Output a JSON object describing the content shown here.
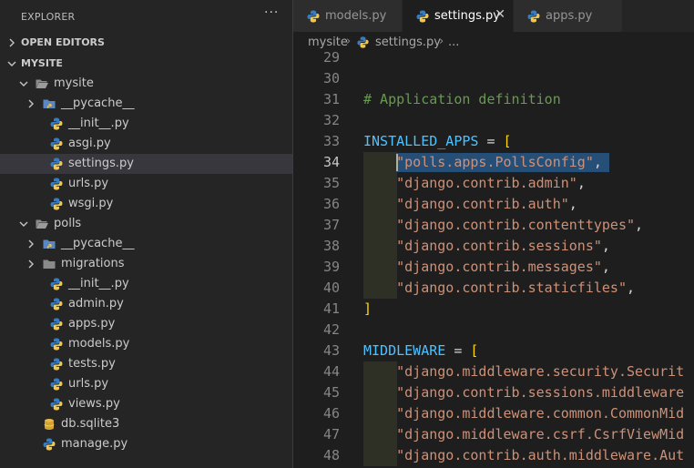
{
  "sidebar": {
    "title": "EXPLORER",
    "more_glyph": "···",
    "open_editors_label": "OPEN EDITORS",
    "project_label": "MYSITE",
    "items": [
      {
        "name": "mysite",
        "type": "folder",
        "expanded": true
      },
      {
        "name": "__pycache__",
        "type": "pycache-folder",
        "expanded": false
      },
      {
        "name": "__init__.py",
        "type": "python"
      },
      {
        "name": "asgi.py",
        "type": "python"
      },
      {
        "name": "settings.py",
        "type": "python",
        "selected": true
      },
      {
        "name": "urls.py",
        "type": "python"
      },
      {
        "name": "wsgi.py",
        "type": "python"
      },
      {
        "name": "polls",
        "type": "folder",
        "expanded": true
      },
      {
        "name": "__pycache__",
        "type": "pycache-folder",
        "expanded": false
      },
      {
        "name": "migrations",
        "type": "folder",
        "expanded": false
      },
      {
        "name": "__init__.py",
        "type": "python"
      },
      {
        "name": "admin.py",
        "type": "python"
      },
      {
        "name": "apps.py",
        "type": "python"
      },
      {
        "name": "models.py",
        "type": "python"
      },
      {
        "name": "tests.py",
        "type": "python"
      },
      {
        "name": "urls.py",
        "type": "python"
      },
      {
        "name": "views.py",
        "type": "python"
      },
      {
        "name": "db.sqlite3",
        "type": "database"
      },
      {
        "name": "manage.py",
        "type": "python"
      }
    ]
  },
  "tabs": [
    {
      "label": "models.py",
      "active": false
    },
    {
      "label": "settings.py",
      "active": true,
      "close_glyph": "✕"
    },
    {
      "label": "apps.py",
      "active": false
    }
  ],
  "breadcrumb": {
    "folder": "mysite",
    "file": "settings.py",
    "sep": "›",
    "tail": "..."
  },
  "editor": {
    "current_line": 34,
    "lines": [
      {
        "n": "29",
        "tokens": []
      },
      {
        "n": "30",
        "tokens": []
      },
      {
        "n": "31",
        "tokens": [
          {
            "t": "# Application definition",
            "k": "comment"
          }
        ]
      },
      {
        "n": "32",
        "tokens": []
      },
      {
        "n": "33",
        "tokens": [
          {
            "t": "INSTALLED_APPS",
            "k": "var"
          },
          {
            "t": " = ",
            "k": "op"
          },
          {
            "t": "[",
            "k": "br"
          }
        ]
      },
      {
        "n": "34",
        "guide": true,
        "tokens": [
          {
            "t": "    ",
            "k": "op"
          },
          {
            "t": "\"polls.apps.PollsConfig\"",
            "k": "str"
          },
          {
            "t": ",",
            "k": "op"
          }
        ]
      },
      {
        "n": "35",
        "guide": true,
        "tokens": [
          {
            "t": "    ",
            "k": "op"
          },
          {
            "t": "\"django.contrib.admin\"",
            "k": "str"
          },
          {
            "t": ",",
            "k": "op"
          }
        ]
      },
      {
        "n": "36",
        "guide": true,
        "tokens": [
          {
            "t": "    ",
            "k": "op"
          },
          {
            "t": "\"django.contrib.auth\"",
            "k": "str"
          },
          {
            "t": ",",
            "k": "op"
          }
        ]
      },
      {
        "n": "37",
        "guide": true,
        "tokens": [
          {
            "t": "    ",
            "k": "op"
          },
          {
            "t": "\"django.contrib.contenttypes\"",
            "k": "str"
          },
          {
            "t": ",",
            "k": "op"
          }
        ]
      },
      {
        "n": "38",
        "guide": true,
        "tokens": [
          {
            "t": "    ",
            "k": "op"
          },
          {
            "t": "\"django.contrib.sessions\"",
            "k": "str"
          },
          {
            "t": ",",
            "k": "op"
          }
        ]
      },
      {
        "n": "39",
        "guide": true,
        "tokens": [
          {
            "t": "    ",
            "k": "op"
          },
          {
            "t": "\"django.contrib.messages\"",
            "k": "str"
          },
          {
            "t": ",",
            "k": "op"
          }
        ]
      },
      {
        "n": "40",
        "guide": true,
        "tokens": [
          {
            "t": "    ",
            "k": "op"
          },
          {
            "t": "\"django.contrib.staticfiles\"",
            "k": "str"
          },
          {
            "t": ",",
            "k": "op"
          }
        ]
      },
      {
        "n": "41",
        "tokens": [
          {
            "t": "]",
            "k": "br"
          }
        ]
      },
      {
        "n": "42",
        "tokens": []
      },
      {
        "n": "43",
        "tokens": [
          {
            "t": "MIDDLEWARE",
            "k": "var"
          },
          {
            "t": " = ",
            "k": "op"
          },
          {
            "t": "[",
            "k": "br"
          }
        ]
      },
      {
        "n": "44",
        "guide": true,
        "tokens": [
          {
            "t": "    ",
            "k": "op"
          },
          {
            "t": "\"django.middleware.security.Securit",
            "k": "str"
          }
        ]
      },
      {
        "n": "45",
        "guide": true,
        "tokens": [
          {
            "t": "    ",
            "k": "op"
          },
          {
            "t": "\"django.contrib.sessions.middleware",
            "k": "str"
          }
        ]
      },
      {
        "n": "46",
        "guide": true,
        "tokens": [
          {
            "t": "    ",
            "k": "op"
          },
          {
            "t": "\"django.middleware.common.CommonMid",
            "k": "str"
          }
        ]
      },
      {
        "n": "47",
        "guide": true,
        "tokens": [
          {
            "t": "    ",
            "k": "op"
          },
          {
            "t": "\"django.middleware.csrf.CsrfViewMid",
            "k": "str"
          }
        ]
      },
      {
        "n": "48",
        "guide": true,
        "tokens": [
          {
            "t": "    ",
            "k": "op"
          },
          {
            "t": "\"django.contrib.auth.middleware.Aut",
            "k": "str"
          }
        ]
      }
    ]
  }
}
